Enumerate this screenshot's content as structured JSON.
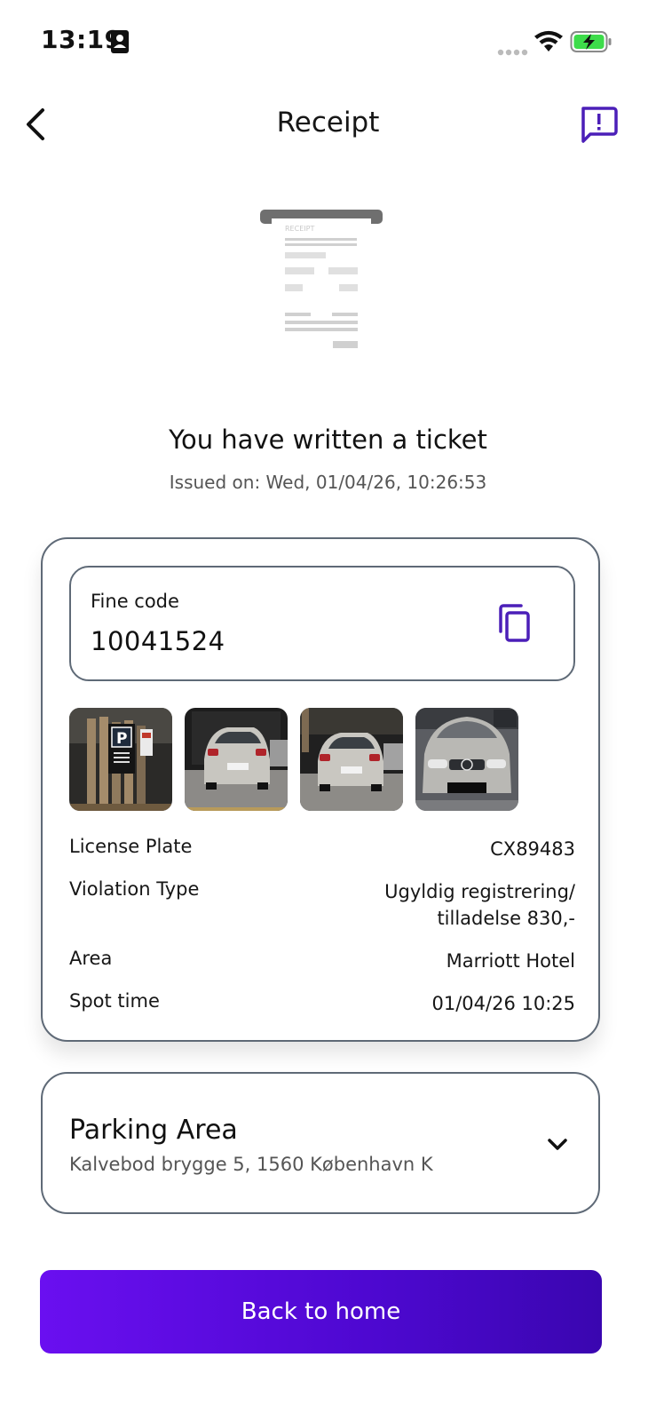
{
  "status_bar": {
    "time": "13:19",
    "icons": [
      "contact-card-icon",
      "signal-dots-icon",
      "wifi-icon",
      "battery-charging-icon"
    ]
  },
  "nav": {
    "title": "Receipt",
    "back_icon": "chevron-left-icon",
    "report_icon": "report-message-icon"
  },
  "illustration": {
    "label": "RECEIPT"
  },
  "ticket": {
    "title": "You have written a ticket",
    "issued_on": "Issued on: Wed, 01/04/26, 10:26:53"
  },
  "fine": {
    "label": "Fine code",
    "code": "10041524",
    "copy_icon": "copy-icon"
  },
  "photos": [
    {
      "description_icon": "parking-sign-photo"
    },
    {
      "description_icon": "car-rear-photo"
    },
    {
      "description_icon": "car-rear-photo"
    },
    {
      "description_icon": "car-front-photo"
    }
  ],
  "details": [
    {
      "label": "License Plate",
      "value_lines": [
        "CX89483"
      ]
    },
    {
      "label": "Violation Type",
      "value_lines": [
        "Ugyldig registrering/",
        "tilladelse 830,-"
      ]
    },
    {
      "label": "Area",
      "value_lines": [
        "Marriott Hotel"
      ]
    },
    {
      "label": "Spot time",
      "value_lines": [
        "01/04/26 10:25"
      ]
    }
  ],
  "parking_area": {
    "title": "Parking Area",
    "address": "Kalvebod brygge 5, 1560 København K",
    "expand_icon": "chevron-down-icon"
  },
  "actions": {
    "home_label": "Back to home"
  },
  "colors": {
    "accent": "#4b1fb8",
    "button_start": "#6a0ff0",
    "button_end": "#3a06b0",
    "border": "#5f6a77",
    "battery_green": "#3ddc4a"
  }
}
